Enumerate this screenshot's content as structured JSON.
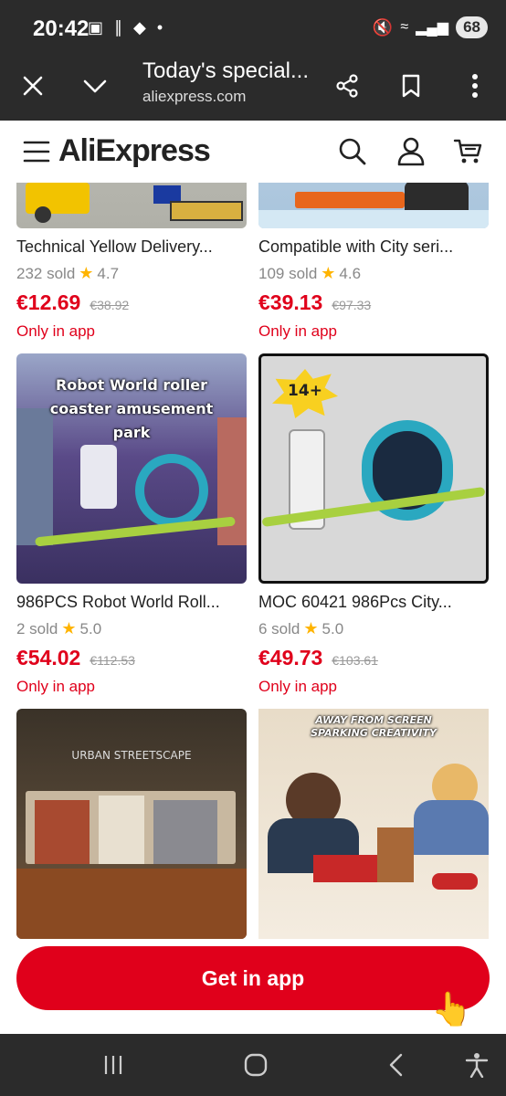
{
  "status_bar": {
    "time": "20:42",
    "battery": "68"
  },
  "browser": {
    "title": "Today's special...",
    "url": "aliexpress.com"
  },
  "header": {
    "logo": "AliExpress"
  },
  "products": [
    {
      "title": "Technical Yellow Delivery...",
      "sold": "232 sold",
      "rating": "4.7",
      "price": "€12.69",
      "old_price": "€38.92",
      "badge": "Only in app"
    },
    {
      "title": "Compatible with City seri...",
      "sold": "109 sold",
      "rating": "4.6",
      "price": "€39.13",
      "old_price": "€97.33",
      "badge": "Only in app"
    },
    {
      "title": "986PCS Robot World Roll...",
      "sold": "2 sold",
      "rating": "5.0",
      "price": "€54.02",
      "old_price": "€112.53",
      "badge": "Only in app",
      "image_caption": "Robot World roller coaster amusement park"
    },
    {
      "title": "MOC 60421 986Pcs City...",
      "sold": "6 sold",
      "rating": "5.0",
      "price": "€49.73",
      "old_price": "€103.61",
      "badge": "Only in app",
      "image_caption": "14+"
    },
    {
      "image_caption": "URBAN STREETSCAPE"
    },
    {
      "image_caption": "AWAY FROM SCREEN SPARKING CREATIVITY"
    }
  ],
  "cta": {
    "label": "Get in app"
  },
  "colors": {
    "accent": "#e0001b",
    "star": "#ffb400",
    "chrome": "#2b2b2b"
  }
}
